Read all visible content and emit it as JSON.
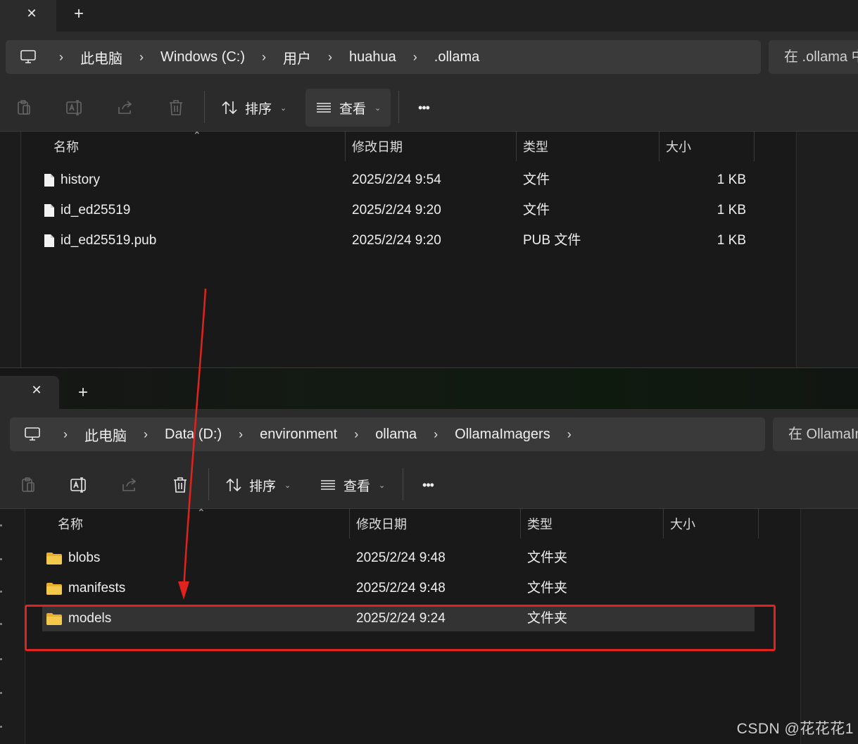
{
  "window_top": {
    "tab": {
      "close_glyph": "✕"
    },
    "new_tab_glyph": "+",
    "breadcrumbs": [
      "此电脑",
      "Windows (C:)",
      "用户",
      "huahua",
      ".ollama"
    ],
    "search_placeholder": "在 .ollama 中",
    "toolbar": {
      "sort_label": "排序",
      "view_label": "查看",
      "more_glyph": "•••"
    },
    "columns": {
      "name": "名称",
      "modified": "修改日期",
      "type": "类型",
      "size": "大小"
    },
    "files": [
      {
        "name": "history",
        "modified": "2025/2/24 9:54",
        "type": "文件",
        "size": "1 KB"
      },
      {
        "name": "id_ed25519",
        "modified": "2025/2/24 9:20",
        "type": "文件",
        "size": "1 KB"
      },
      {
        "name": "id_ed25519.pub",
        "modified": "2025/2/24 9:20",
        "type": "PUB 文件",
        "size": "1 KB"
      }
    ]
  },
  "window_bottom": {
    "tab": {
      "close_glyph": "✕"
    },
    "new_tab_glyph": "+",
    "breadcrumbs": [
      "此电脑",
      "Data (D:)",
      "environment",
      "ollama",
      "OllamaImagers"
    ],
    "search_placeholder": "在 OllamaImagers 中",
    "toolbar": {
      "sort_label": "排序",
      "view_label": "查看",
      "more_glyph": "•••"
    },
    "columns": {
      "name": "名称",
      "modified": "修改日期",
      "type": "类型",
      "size": "大小"
    },
    "folders": [
      {
        "name": "blobs",
        "modified": "2025/2/24 9:48",
        "type": "文件夹"
      },
      {
        "name": "manifests",
        "modified": "2025/2/24 9:48",
        "type": "文件夹"
      },
      {
        "name": "models",
        "modified": "2025/2/24 9:24",
        "type": "文件夹",
        "selected": true
      }
    ]
  },
  "annotation": {
    "arrow_color": "#e0231c",
    "box_color": "#e0231c"
  },
  "watermark": "CSDN @花花花1",
  "colors": {
    "folder": "#f4c84a",
    "file": "#f2f2f2",
    "background": "#191919"
  }
}
